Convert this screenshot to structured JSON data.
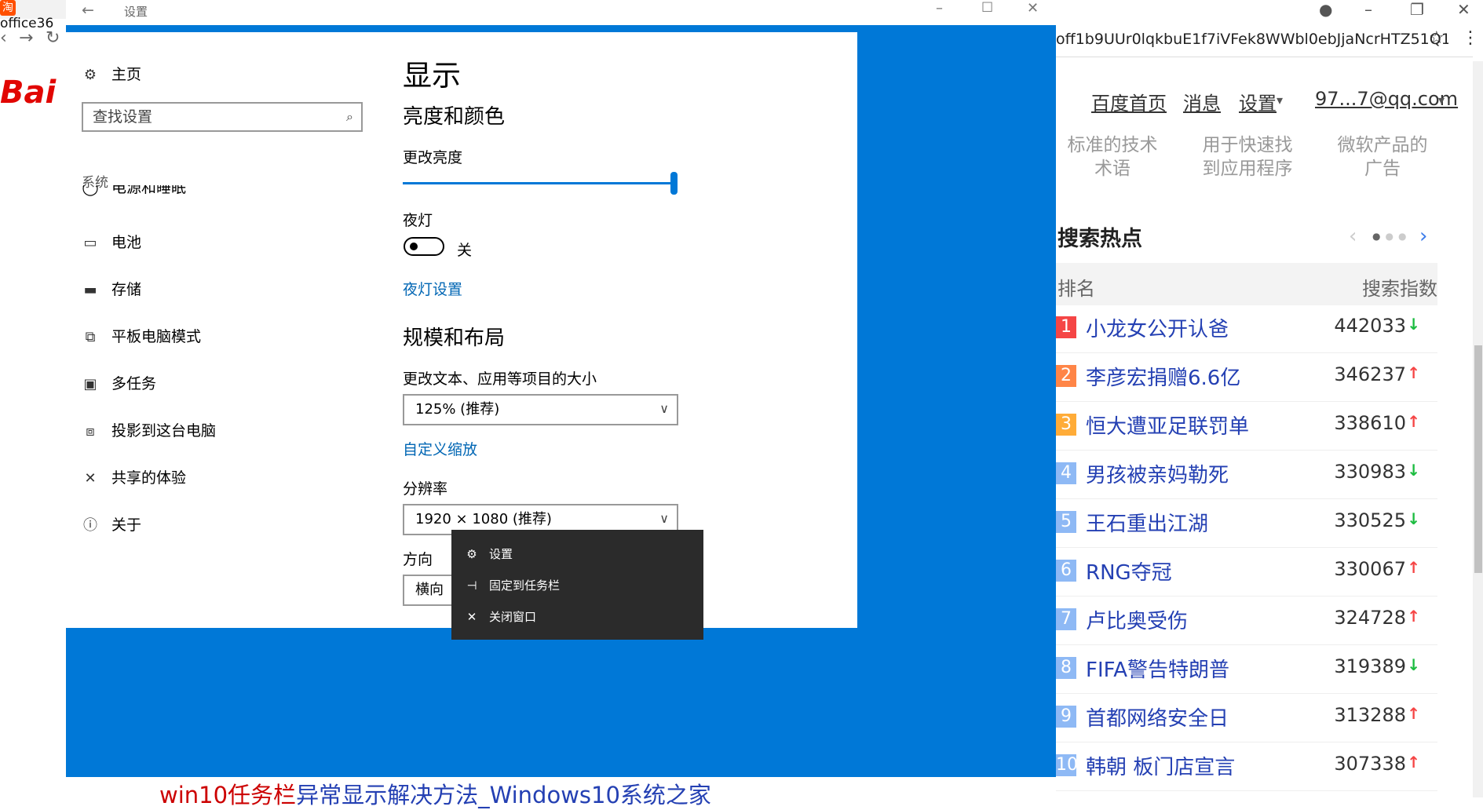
{
  "browser": {
    "tab_title": "office36",
    "tab_favicon": "淘",
    "url": "off1b9UUr0lqkbuE1f7iVFek8WWbl0ebJjaNcrHTZ51Q1...",
    "logo_text": "Bai",
    "nav": [
      "百度首页",
      "消息",
      "设置",
      "97...7@qq.com"
    ],
    "teasers": [
      [
        "标准的技术",
        "术语"
      ],
      [
        "用于快速找",
        "到应用程序"
      ],
      [
        "微软产品的",
        "广告"
      ]
    ],
    "hot_title": "搜索热点",
    "hot_header": {
      "rank": "排名",
      "index": "搜索指数"
    },
    "hot_items": [
      {
        "rank": "1",
        "text": "小龙女公开认爸",
        "value": "442033",
        "trend": "down",
        "color": "#f54545"
      },
      {
        "rank": "2",
        "text": "李彦宏捐赠6.6亿",
        "value": "346237",
        "trend": "up",
        "color": "#ff8547"
      },
      {
        "rank": "3",
        "text": "恒大遭亚足联罚单",
        "value": "338610",
        "trend": "up",
        "color": "#ffac38"
      },
      {
        "rank": "4",
        "text": "男孩被亲妈勒死",
        "value": "330983",
        "trend": "down",
        "color": "#8eb9f5"
      },
      {
        "rank": "5",
        "text": "王石重出江湖",
        "value": "330525",
        "trend": "down",
        "color": "#8eb9f5"
      },
      {
        "rank": "6",
        "text": "RNG夺冠",
        "value": "330067",
        "trend": "up",
        "color": "#8eb9f5"
      },
      {
        "rank": "7",
        "text": "卢比奥受伤",
        "value": "324728",
        "trend": "up",
        "color": "#8eb9f5"
      },
      {
        "rank": "8",
        "text": "FIFA警告特朗普",
        "value": "319389",
        "trend": "down",
        "color": "#8eb9f5"
      },
      {
        "rank": "9",
        "text": "首都网络安全日",
        "value": "313288",
        "trend": "up",
        "color": "#8eb9f5"
      },
      {
        "rank": "10",
        "text": "韩朝 板门店宣言",
        "value": "307338",
        "trend": "up",
        "color": "#8eb9f5"
      }
    ],
    "bottom_link_red": "win10任务栏",
    "bottom_link_blue": "异常显示解决方法_Windows10系统之家"
  },
  "settings": {
    "window_title": "设置",
    "home_label": "主页",
    "search_placeholder": "查找设置",
    "section_label": "系统",
    "partial_item": "电源和睡眠",
    "sidebar_items": [
      {
        "icon": "battery-icon",
        "glyph": "▭",
        "label": "电池"
      },
      {
        "icon": "storage-icon",
        "glyph": "▬",
        "label": "存储"
      },
      {
        "icon": "tablet-mode-icon",
        "glyph": "⧉",
        "label": "平板电脑模式"
      },
      {
        "icon": "multitask-icon",
        "glyph": "▣",
        "label": "多任务"
      },
      {
        "icon": "project-icon",
        "glyph": "⧈",
        "label": "投影到这台电脑"
      },
      {
        "icon": "share-icon",
        "glyph": "✕",
        "label": "共享的体验"
      },
      {
        "icon": "about-icon",
        "glyph": "ⓘ",
        "label": "关于"
      }
    ],
    "page_title": "显示",
    "brightness_heading": "亮度和颜色",
    "brightness_label": "更改亮度",
    "brightness_value": 1.0,
    "nightlight_label": "夜灯",
    "nightlight_state": "关",
    "nightlight_link": "夜灯设置",
    "scale_heading": "规模和布局",
    "scale_label": "更改文本、应用等项目的大小",
    "scale_value": "125% (推荐)",
    "custom_scale_link": "自定义缩放",
    "resolution_label": "分辨率",
    "resolution_value": "1920 × 1080 (推荐)",
    "orientation_label": "方向",
    "orientation_value": "横向"
  },
  "context_menu": [
    {
      "icon": "gear-icon",
      "glyph": "⚙",
      "label": "设置"
    },
    {
      "icon": "pin-icon",
      "glyph": "⊣",
      "label": "固定到任务栏"
    },
    {
      "icon": "close-icon",
      "glyph": "✕",
      "label": "关闭窗口"
    }
  ],
  "colors": {
    "accent": "#0078d7",
    "link": "#0066b4",
    "menu_bg": "#2b2b2b",
    "baidu_red": "#e10602",
    "hot_link": "#2440b3",
    "up": "#f54545",
    "down": "#1cbc40"
  }
}
